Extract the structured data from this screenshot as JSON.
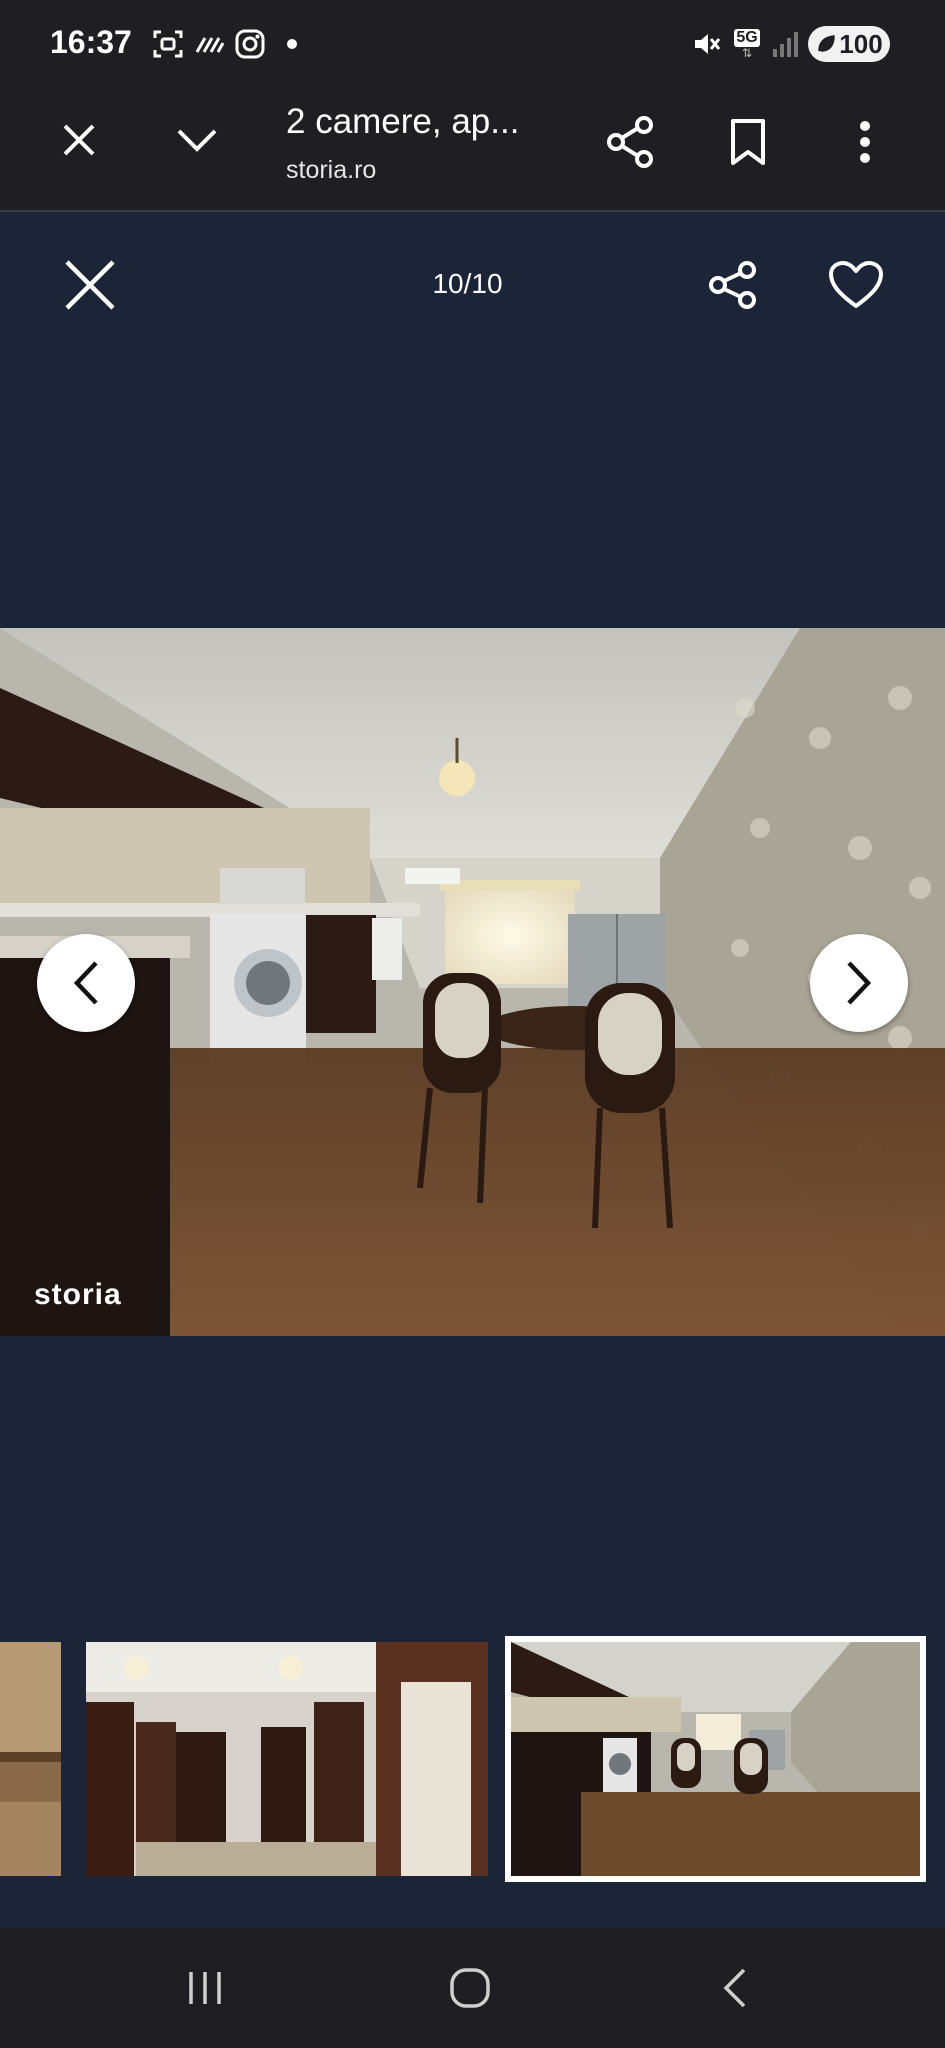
{
  "status_bar": {
    "time": "16:37",
    "network": "5G",
    "battery": "100",
    "icons": [
      "screenshot-icon",
      "nfc-icon",
      "instagram-icon",
      "notification-dot-icon",
      "mute-icon",
      "signal-icon",
      "battery-saver-icon"
    ]
  },
  "toolbar": {
    "page_title": "2 camere, ap...",
    "domain": "storia.ro",
    "icons": [
      "close-icon",
      "chevron-down-icon",
      "share-icon",
      "bookmark-icon",
      "more-vert-icon"
    ]
  },
  "gallery": {
    "counter": "10/10",
    "watermark": "storia",
    "icons": [
      "close-icon",
      "share-icon",
      "heart-icon",
      "chevron-left-icon",
      "chevron-right-icon"
    ],
    "thumbnails": [
      {
        "subject": "floor",
        "active": false
      },
      {
        "subject": "hallway",
        "active": false
      },
      {
        "subject": "kitchen",
        "active": true
      }
    ]
  },
  "colors": {
    "gallery_background": "#1c2438",
    "bar_background": "#1f1f23",
    "text": "#ffffff"
  },
  "system_nav": {
    "icons": [
      "recents-icon",
      "home-icon",
      "back-icon"
    ]
  }
}
